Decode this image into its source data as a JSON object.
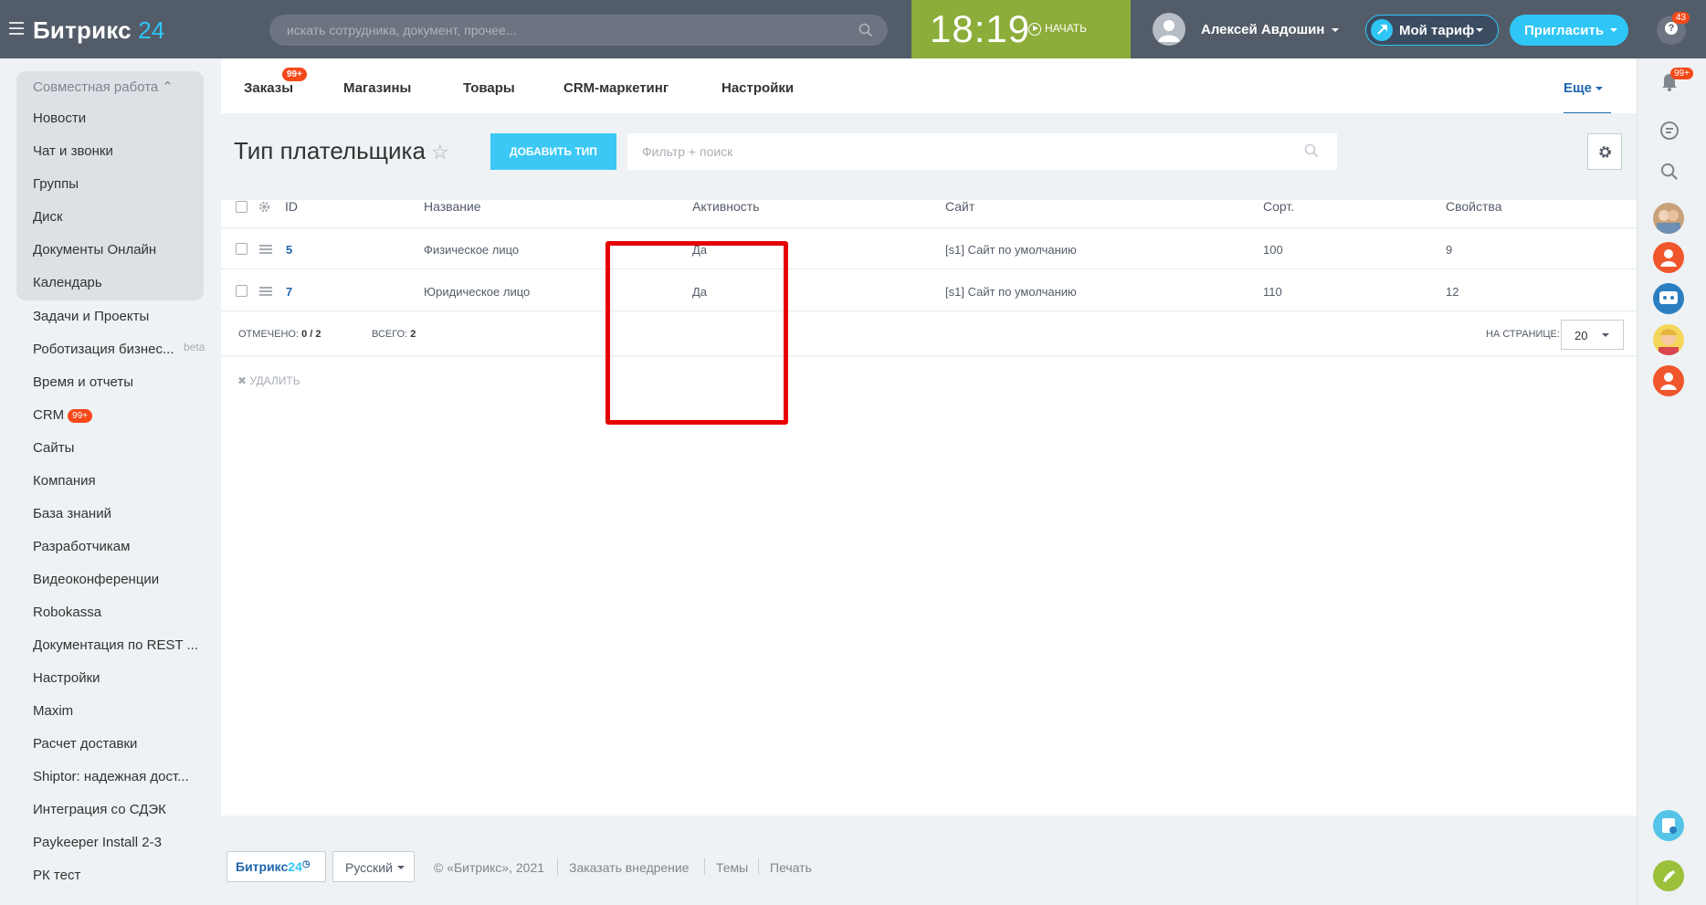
{
  "topbar": {
    "logo_text": "Битрикс",
    "logo_num": "24",
    "search_placeholder": "искать сотрудника, документ, прочее...",
    "clock_time": "18:19",
    "start_label": "НАЧАТЬ",
    "user_name": "Алексей Авдошин",
    "tariff_label": "Мой тариф",
    "invite_label": "Пригласить",
    "help_badge": "43"
  },
  "sidebar": {
    "group_header": "Совместная работа",
    "group_items": [
      {
        "label": "Новости"
      },
      {
        "label": "Чат и звонки"
      },
      {
        "label": "Группы"
      },
      {
        "label": "Диск"
      },
      {
        "label": "Документы Онлайн"
      },
      {
        "label": "Календарь"
      }
    ],
    "items": [
      {
        "label": "Задачи и Проекты"
      },
      {
        "label": "Роботизация бизнес..."
      },
      {
        "label": "Время и отчеты"
      },
      {
        "label": "CRM"
      },
      {
        "label": "Сайты"
      },
      {
        "label": "Компания"
      },
      {
        "label": "База знаний"
      },
      {
        "label": "Разработчикам"
      },
      {
        "label": "Видеоконференции"
      },
      {
        "label": "Robokassa"
      },
      {
        "label": "Документация по REST ..."
      },
      {
        "label": "Настройки"
      },
      {
        "label": "Maxim"
      },
      {
        "label": "Расчет доставки"
      },
      {
        "label": "Shiptor: надежная дост..."
      },
      {
        "label": "Интеграция со СДЭК"
      },
      {
        "label": "Paykeeper Install 2-3"
      },
      {
        "label": "РК тест"
      }
    ],
    "beta_label": "beta",
    "crm_badge": "99+"
  },
  "tabs": {
    "items": [
      {
        "label": "Заказы"
      },
      {
        "label": "Магазины"
      },
      {
        "label": "Товары"
      },
      {
        "label": "CRM-маркетинг"
      },
      {
        "label": "Настройки"
      }
    ],
    "orders_badge": "99+",
    "more_label": "Еще"
  },
  "page": {
    "title": "Тип плательщика",
    "add_button": "ДОБАВИТЬ ТИП",
    "filter_placeholder": "Фильтр + поиск"
  },
  "table": {
    "headers": [
      "ID",
      "Название",
      "Активность",
      "Сайт",
      "Сорт.",
      "Свойства"
    ],
    "rows": [
      {
        "id": "5",
        "name": "Физическое лицо",
        "active": "Да",
        "site": "[s1] Сайт по умолчанию",
        "sort": "100",
        "props": "9"
      },
      {
        "id": "7",
        "name": "Юридическое лицо",
        "active": "Да",
        "site": "[s1] Сайт по умолчанию",
        "sort": "110",
        "props": "12"
      }
    ],
    "selected_label": "ОТМЕЧЕНО:",
    "selected_value": "0 / 2",
    "total_label": "ВСЕГО:",
    "total_value": "2",
    "per_page_label": "НА СТРАНИЦЕ:",
    "per_page_value": "20",
    "delete_label": "УДАЛИТЬ"
  },
  "footer": {
    "logo_text": "Битрикс",
    "logo_num": "24",
    "language": "Русский",
    "copyright": "© «Битрикс», 2021",
    "order_impl": "Заказать внедрение",
    "themes": "Темы",
    "print": "Печать"
  },
  "rightbar": {
    "notifications_badge": "99+"
  },
  "colors": {
    "topbar": "#535c69",
    "clock": "#8cad3a",
    "accent": "#2fc6f6",
    "link": "#2067b0",
    "badge": "#f54819",
    "highlight_box": "#e60000"
  }
}
